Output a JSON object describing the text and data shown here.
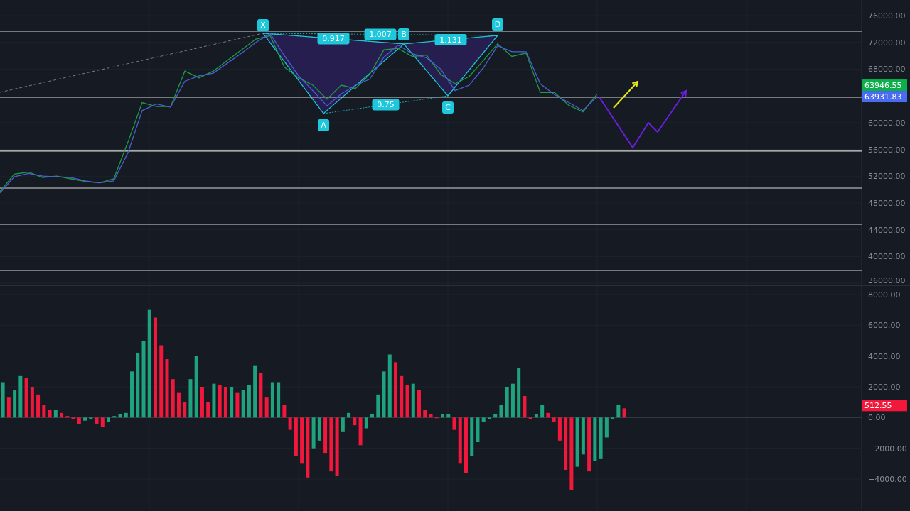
{
  "price_pane": {
    "chart_data": {
      "type": "line",
      "grid": true,
      "ylim": [
        35576,
        78334
      ],
      "yticks": [
        {
          "value": 76000,
          "label": "76000.00"
        },
        {
          "value": 72000,
          "label": "72000.00"
        },
        {
          "value": 68000,
          "label": "68000.00"
        },
        {
          "value": 60000,
          "label": "60000.00"
        },
        {
          "value": 56000,
          "label": "56000.00"
        },
        {
          "value": 52000,
          "label": "52000.00"
        },
        {
          "value": 48000,
          "label": "48000.00"
        },
        {
          "value": 44000,
          "label": "44000.00"
        },
        {
          "value": 40000,
          "label": "40000.00"
        },
        {
          "value": 36000,
          "label": "36000.00"
        }
      ],
      "series": [
        {
          "color": "#1e9c45",
          "values": [
            49700,
            52300,
            52600,
            51800,
            52000,
            51600,
            51200,
            51000,
            51600,
            57100,
            63000,
            62400,
            62400,
            67700,
            66700,
            67700,
            69300,
            70900,
            72500,
            73000,
            68300,
            66700,
            65600,
            63500,
            65600,
            65100,
            67200,
            70900,
            71100,
            69900,
            70100,
            67200,
            65800,
            66900,
            69300,
            71800,
            69900,
            70400,
            64500,
            64500,
            62600,
            61600,
            64300
          ]
        },
        {
          "color": "#4a5fd8",
          "values": [
            49500,
            51900,
            52400,
            52000,
            51900,
            51800,
            51300,
            51000,
            51300,
            55500,
            61800,
            62800,
            62300,
            66200,
            67000,
            67400,
            68900,
            70400,
            72000,
            73300,
            70000,
            67000,
            64800,
            62500,
            64300,
            65600,
            66500,
            69800,
            71600,
            70300,
            69700,
            68000,
            64800,
            65600,
            68200,
            71500,
            70600,
            70600,
            65800,
            64200,
            63000,
            61800,
            63900
          ]
        }
      ]
    },
    "price_badges": [
      {
        "text": "63946.55",
        "color": "#0bb04a"
      },
      {
        "text": "63931.83",
        "color": "#4a6cf0"
      }
    ],
    "pattern": {
      "points": [
        "X",
        "A",
        "B",
        "C",
        "D"
      ],
      "ratios": [
        "0.917",
        "1.007",
        "1.131",
        "0.75"
      ]
    }
  },
  "oscillator_pane": {
    "chart_data": {
      "type": "bar",
      "grid": true,
      "ylim": [
        -6031,
        8554
      ],
      "yticks": [
        {
          "value": 8000,
          "label": "8000.00"
        },
        {
          "value": 6000,
          "label": "6000.00"
        },
        {
          "value": 4000,
          "label": "4000.00"
        },
        {
          "value": 2000,
          "label": "2000.00"
        },
        {
          "value": 0,
          "label": "0.00"
        },
        {
          "value": -2000,
          "label": "−2000.00"
        },
        {
          "value": -4000,
          "label": "−4000.00"
        }
      ],
      "series": [
        {
          "values": [
            2300,
            1300,
            1800,
            2700,
            2600,
            2000,
            1500,
            800,
            500,
            500,
            300,
            100,
            -100,
            -400,
            -200,
            -100,
            -400,
            -600,
            -300,
            100,
            200,
            300,
            3000,
            4200,
            5000,
            7000,
            6500,
            4700,
            3800,
            2500,
            1600,
            1000,
            2500,
            4000,
            2000,
            1000,
            2200,
            2100,
            2000,
            2000,
            1600,
            1800,
            2100,
            3400,
            2900,
            1300,
            2300,
            2300,
            800,
            -800,
            -2500,
            -3000,
            -3900,
            -2000,
            -1500,
            -2300,
            -3500,
            -3800,
            -900,
            300,
            -500,
            -1800,
            -700,
            200,
            1500,
            3000,
            4100,
            3600,
            2700,
            2100,
            2200,
            1800,
            500,
            200,
            0,
            200,
            200,
            -800,
            -3000,
            -3600,
            -2500,
            -1600,
            -300,
            -100,
            200,
            800,
            2000,
            2200,
            3200,
            1400,
            -100,
            200,
            800,
            300,
            -300,
            -1500,
            -3400,
            -4700,
            -3200,
            -2400,
            -3500,
            -2800,
            -2700,
            -1300,
            -100,
            800,
            600,
            null,
            null,
            null,
            null,
            null,
            null,
            null,
            null,
            null,
            null,
            null,
            null,
            null,
            null,
            null,
            null,
            null,
            null,
            null,
            null,
            null,
            null,
            null,
            null,
            null,
            null,
            null,
            null,
            null,
            null,
            null,
            null,
            null,
            null,
            null,
            null,
            null,
            null,
            null,
            null
          ]
        }
      ]
    },
    "value_badge": {
      "text": "512.55"
    }
  }
}
